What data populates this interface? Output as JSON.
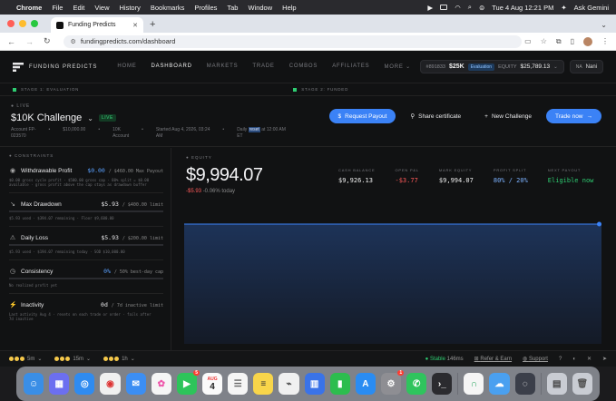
{
  "menubar": {
    "app": "Chrome",
    "items": [
      "File",
      "Edit",
      "View",
      "History",
      "Bookmarks",
      "Profiles",
      "Tab",
      "Window",
      "Help"
    ],
    "clock": "Tue 4 Aug  12:21 PM",
    "assistant": "Ask Gemini"
  },
  "browser": {
    "tab_title": "Funding Predicts",
    "url": "fundingpredicts.com/dashboard"
  },
  "nav": {
    "brand": "FUNDING PREDICTS",
    "links": [
      "HOME",
      "DASHBOARD",
      "MARKETS",
      "TRADE",
      "COMBOS",
      "AFFILIATES",
      "MORE ⌄"
    ],
    "account_id": "#891833",
    "account_size": "$25K",
    "account_badge": "Evaluation",
    "equity_label": "EQUITY",
    "equity_value": "$25,789.13",
    "user_initials": "NA",
    "user_name": "Nani"
  },
  "stages": {
    "stage1": "STAGE 1: EVALUATION",
    "stage2": "STAGE 2: FUNDED"
  },
  "header": {
    "live_label": "LIVE",
    "title": "$10K Challenge",
    "badge": "LIVE",
    "account_line1": "Account FP-",
    "account_line2": "023570",
    "balance": "$10,000.00",
    "size_line1": "10K",
    "size_line2": "Account",
    "started_line1": "Started Aug 4, 2026, 03:24",
    "started_line2": "AM",
    "daily_prefix": "Daily",
    "daily_highlight": "reset",
    "daily_suffix": "at 12:00 AM",
    "daily_line2": "ET",
    "btn_payout": "Request Payout",
    "btn_share": "Share certificate",
    "btn_new": "New Challenge",
    "btn_trade": "Trade now"
  },
  "constraints": {
    "label": "CONSTRAINTS",
    "items": [
      {
        "name": "Withdrawable Profit",
        "value": "$0.00",
        "suffix": "/ $460.00 Max Payout",
        "sub1": "$0.00 gross cycle profit · $500.00 gross cap · 80% split = $0.00",
        "sub2": "available · gross profit above the cap stays as drawdown buffer"
      },
      {
        "name": "Max Drawdown",
        "value": "$5.93",
        "suffix": "/ $400.00 limit",
        "sub1": "$5.93 used · $394.07 remaining · Floor $9,600.00"
      },
      {
        "name": "Daily Loss",
        "value": "$5.93",
        "suffix": "/ $200.00 limit",
        "sub1": "$5.93 used · $194.07 remaining today · SOD $10,000.00"
      },
      {
        "name": "Consistency",
        "value": "0%",
        "suffix": "/ 50% best-day cap",
        "sub1": "No realized profit yet"
      },
      {
        "name": "Inactivity",
        "value": "0d",
        "suffix": "/ 7d inactive limit",
        "sub1": "Last activity Aug 4 · resets on each trade or order · fails after",
        "sub2": "7d inactive"
      }
    ]
  },
  "equity": {
    "label": "EQUITY",
    "value": "$9,994.07",
    "delta": "-$5.93",
    "delta_pct": "-0.06% today",
    "stats": [
      {
        "k": "CASH BALANCE",
        "v": "$9,926.13",
        "tone": "white"
      },
      {
        "k": "OPEN P&L",
        "v": "-$3.77",
        "tone": "red"
      },
      {
        "k": "MARK EQUITY",
        "v": "$9,994.07",
        "tone": "white"
      },
      {
        "k": "PROFIT SPLIT",
        "v": "80% / 20%",
        "tone": "blue"
      },
      {
        "k": "NEXT PAYOUT",
        "v": "Eligible now",
        "tone": "green"
      }
    ]
  },
  "chart_data": {
    "type": "area",
    "title": "",
    "xlabel": "",
    "ylabel": "",
    "x": [
      0,
      1
    ],
    "series": [
      {
        "values": [
          9994.07,
          9994.07
        ]
      }
    ],
    "ylim": [
      0,
      9994.07
    ],
    "grid": false,
    "legend": "none",
    "colors": {
      "line": "#3b82f6",
      "fill": "#1a2a4a"
    }
  },
  "statusbar": {
    "tf1": "5m",
    "tf2": "15m",
    "tf3": "1h",
    "status": "Stable",
    "latency": "146ms",
    "refer": "Refer & Earn",
    "support": "Support"
  },
  "dock": {
    "calendar_month": "AUG",
    "calendar_day": "4",
    "facetime_badge": "5",
    "settings_badge": "1"
  }
}
